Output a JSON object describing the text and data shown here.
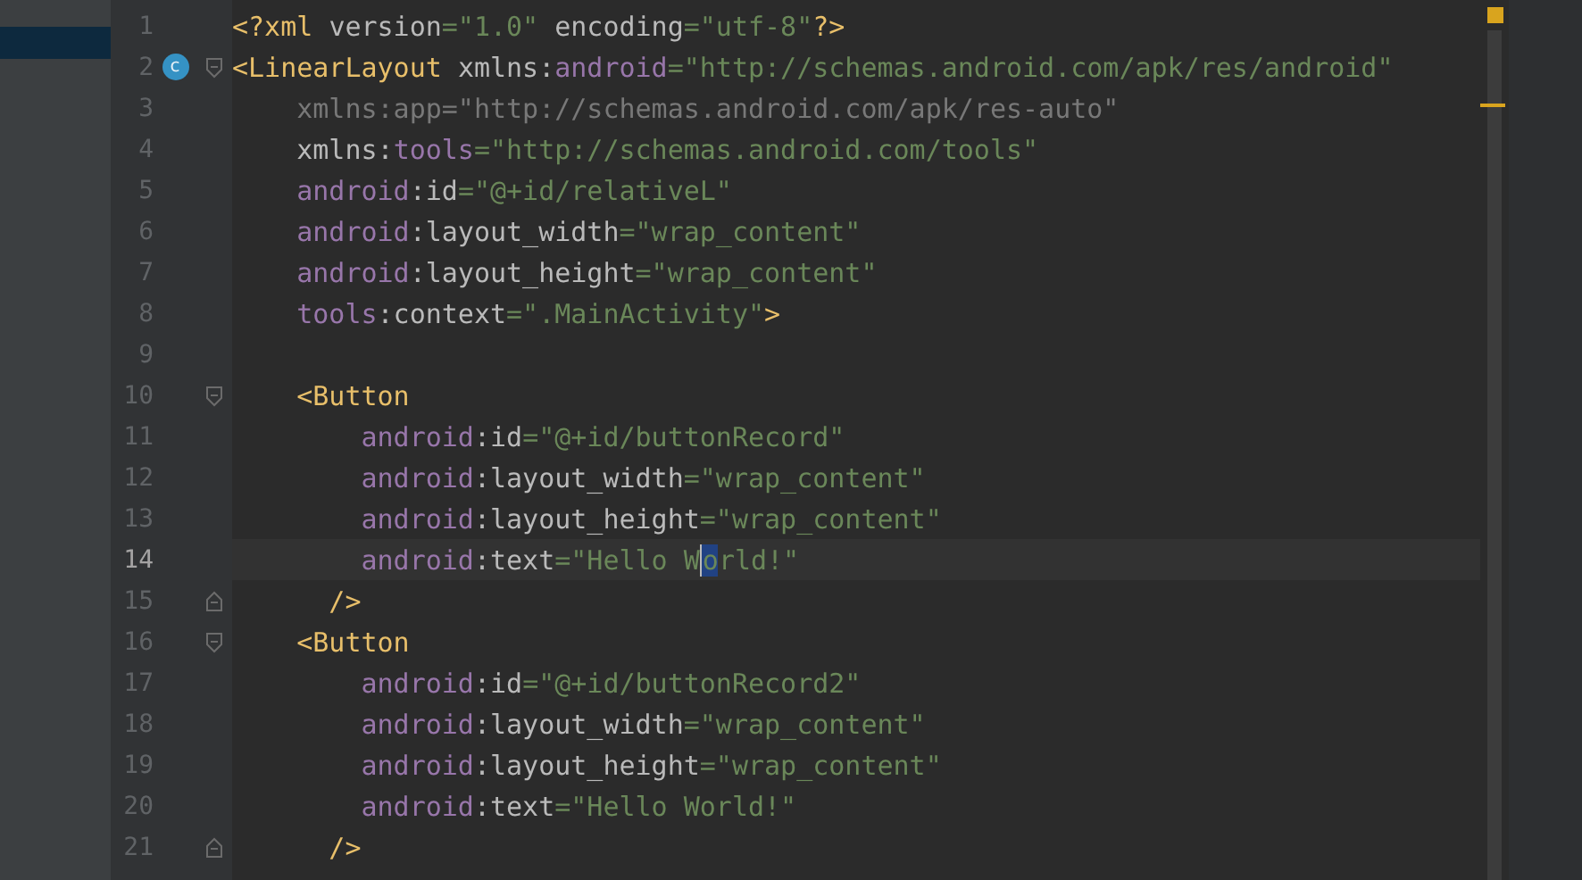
{
  "sidebar": {
    "highlighted_row": true
  },
  "editor": {
    "lines": [
      {
        "number": "1",
        "current": false,
        "tokens": [
          {
            "kind": "tag",
            "text": "<?xml "
          },
          {
            "kind": "attr",
            "text": "version"
          },
          {
            "kind": "value",
            "text": "=\"1.0\" "
          },
          {
            "kind": "attr",
            "text": "encoding"
          },
          {
            "kind": "value",
            "text": "=\"utf-8\""
          },
          {
            "kind": "tag",
            "text": "?>"
          }
        ]
      },
      {
        "number": "2",
        "current": false,
        "badge": "c",
        "fold_start": true,
        "tokens": [
          {
            "kind": "tag",
            "text": "<LinearLayout "
          },
          {
            "kind": "attr",
            "text": "xmlns:"
          },
          {
            "kind": "ns",
            "text": "android"
          },
          {
            "kind": "value",
            "text": "=\"http://schemas.android.com/apk/res/android\""
          }
        ]
      },
      {
        "number": "3",
        "current": false,
        "tokens": [
          {
            "kind": "muted",
            "text": "    xmlns:app=\"http://schemas.android.com/apk/res-auto\""
          }
        ]
      },
      {
        "number": "4",
        "current": false,
        "tokens": [
          {
            "kind": "attr",
            "text": "    xmlns:"
          },
          {
            "kind": "ns",
            "text": "tools"
          },
          {
            "kind": "value",
            "text": "=\"http://schemas.android.com/tools\""
          }
        ]
      },
      {
        "number": "5",
        "current": false,
        "tokens": [
          {
            "kind": "ns",
            "text": "    android"
          },
          {
            "kind": "attr",
            "text": ":id"
          },
          {
            "kind": "value",
            "text": "=\"@+id/relativeL\""
          }
        ]
      },
      {
        "number": "6",
        "current": false,
        "tokens": [
          {
            "kind": "ns",
            "text": "    android"
          },
          {
            "kind": "attr",
            "text": ":layout_width"
          },
          {
            "kind": "value",
            "text": "=\"wrap_content\""
          }
        ]
      },
      {
        "number": "7",
        "current": false,
        "tokens": [
          {
            "kind": "ns",
            "text": "    android"
          },
          {
            "kind": "attr",
            "text": ":layout_height"
          },
          {
            "kind": "value",
            "text": "=\"wrap_content\""
          }
        ]
      },
      {
        "number": "8",
        "current": false,
        "tokens": [
          {
            "kind": "ns",
            "text": "    tools"
          },
          {
            "kind": "attr",
            "text": ":context"
          },
          {
            "kind": "value",
            "text": "=\".MainActivity\""
          },
          {
            "kind": "tag",
            "text": ">"
          }
        ]
      },
      {
        "number": "9",
        "current": false
      },
      {
        "number": "10",
        "current": false,
        "fold_start": true,
        "tokens": [
          {
            "kind": "tag",
            "text": "    <Button"
          }
        ]
      },
      {
        "number": "11",
        "current": false,
        "tokens": [
          {
            "kind": "ns",
            "text": "        android"
          },
          {
            "kind": "attr",
            "text": ":id"
          },
          {
            "kind": "value",
            "text": "=\"@+id/buttonRecord\""
          }
        ]
      },
      {
        "number": "12",
        "current": false,
        "tokens": [
          {
            "kind": "ns",
            "text": "        android"
          },
          {
            "kind": "attr",
            "text": ":layout_width"
          },
          {
            "kind": "value",
            "text": "=\"wrap_content\""
          }
        ]
      },
      {
        "number": "13",
        "current": false,
        "tokens": [
          {
            "kind": "ns",
            "text": "        android"
          },
          {
            "kind": "attr",
            "text": ":layout_height"
          },
          {
            "kind": "value",
            "text": "=\"wrap_content\""
          }
        ]
      },
      {
        "number": "14",
        "current": true,
        "tokens": [
          {
            "kind": "ns",
            "text": "        android"
          },
          {
            "kind": "attr",
            "text": ":text"
          },
          {
            "kind": "value",
            "text": "=\"Hello W"
          },
          {
            "kind": "selected",
            "text": "o"
          },
          {
            "kind": "value",
            "text": "rld!\""
          }
        ]
      },
      {
        "number": "15",
        "current": false,
        "fold_end": true,
        "tokens": [
          {
            "kind": "tag",
            "text": "      />"
          }
        ]
      },
      {
        "number": "16",
        "current": false,
        "fold_start": true,
        "tokens": [
          {
            "kind": "tag",
            "text": "    <Button"
          }
        ]
      },
      {
        "number": "17",
        "current": false,
        "tokens": [
          {
            "kind": "ns",
            "text": "        android"
          },
          {
            "kind": "attr",
            "text": ":id"
          },
          {
            "kind": "value",
            "text": "=\"@+id/buttonRecord2\""
          }
        ]
      },
      {
        "number": "18",
        "current": false,
        "tokens": [
          {
            "kind": "ns",
            "text": "        android"
          },
          {
            "kind": "attr",
            "text": ":layout_width"
          },
          {
            "kind": "value",
            "text": "=\"wrap_content\""
          }
        ]
      },
      {
        "number": "19",
        "current": false,
        "tokens": [
          {
            "kind": "ns",
            "text": "        android"
          },
          {
            "kind": "attr",
            "text": ":layout_height"
          },
          {
            "kind": "value",
            "text": "=\"wrap_content\""
          }
        ]
      },
      {
        "number": "20",
        "current": false,
        "tokens": [
          {
            "kind": "ns",
            "text": "        android"
          },
          {
            "kind": "attr",
            "text": ":text"
          },
          {
            "kind": "value",
            "text": "=\"Hello World!\""
          }
        ]
      },
      {
        "number": "21",
        "current": false,
        "fold_end": true,
        "tokens": [
          {
            "kind": "tag",
            "text": "      />"
          }
        ]
      }
    ]
  }
}
